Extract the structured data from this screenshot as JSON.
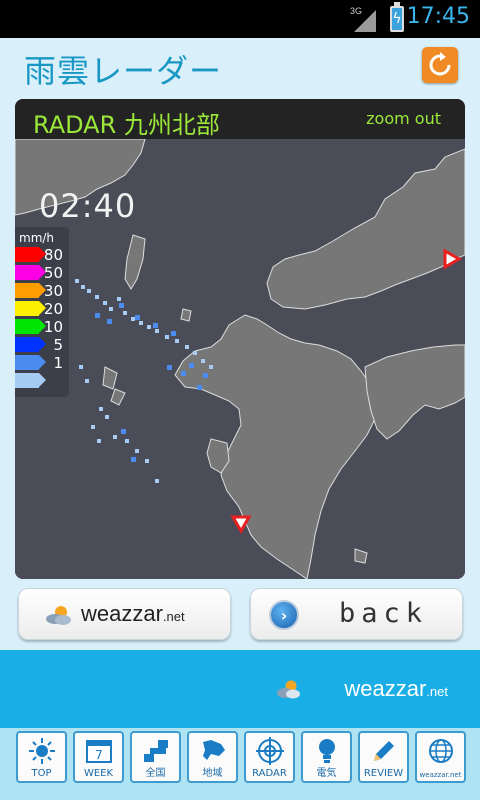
{
  "status_bar": {
    "network": "3G",
    "time": "17:45"
  },
  "header": {
    "title": "雨雲レーダー",
    "refresh_icon": "refresh-icon"
  },
  "radar": {
    "title": "RADAR 九州北部",
    "zoom_out_label": "zoom out",
    "time": "02:40",
    "legend": {
      "unit": "mm/h",
      "levels": [
        {
          "value": "80",
          "color": "#ff0000"
        },
        {
          "value": "50",
          "color": "#ff00e6"
        },
        {
          "value": "30",
          "color": "#ff9c00"
        },
        {
          "value": "20",
          "color": "#fff000"
        },
        {
          "value": "10",
          "color": "#00e600"
        },
        {
          "value": "5",
          "color": "#0033ff"
        },
        {
          "value": "1",
          "color": "#4a8cf0"
        },
        {
          "value": "",
          "color": "#a6ccf5"
        }
      ]
    }
  },
  "buttons": {
    "weazzar": {
      "brand": "weazzar",
      "suffix": ".net"
    },
    "back": {
      "label": "back"
    }
  },
  "ad": {
    "brand": "weazzar",
    "suffix": ".net"
  },
  "nav": {
    "items": [
      {
        "label": "TOP",
        "icon": "sun-icon"
      },
      {
        "label": "WEEK",
        "icon": "calendar-icon",
        "badge": "7"
      },
      {
        "label": "全国",
        "icon": "japan-map-icon"
      },
      {
        "label": "地域",
        "icon": "hokkaido-icon"
      },
      {
        "label": "RADAR",
        "icon": "radar-icon"
      },
      {
        "label": "電気",
        "icon": "lightbulb-icon"
      },
      {
        "label": "REVIEW",
        "icon": "pencil-icon"
      },
      {
        "label": "weazzar.net",
        "icon": "globe-icon"
      }
    ]
  },
  "colors": {
    "accent": "#1a98c4",
    "header_bg": "#d9f0fb",
    "radar_title": "#9be83a",
    "refresh": "#f08a24",
    "ad_bg": "#1aaee6"
  }
}
